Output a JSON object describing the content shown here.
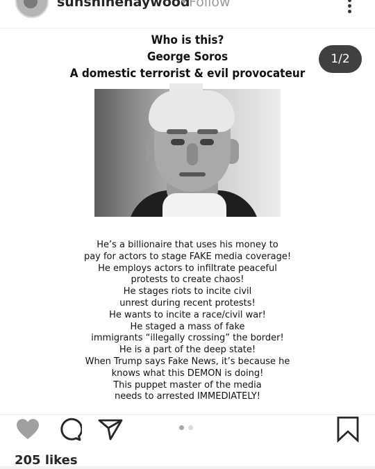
{
  "header": {
    "username": "sunshinehaywood",
    "separator": "•",
    "follow_label": "Follow"
  },
  "post": {
    "counter": "1/2",
    "headline": [
      "Who is this?",
      "George Soros",
      "A domestic terrorist & evil provocateur"
    ],
    "body_lines": [
      "He’s a billionaire that uses his money to",
      "pay for actors to stage FAKE media coverage!",
      "He employs actors to infiltrate peaceful",
      "protests to create chaos!",
      "He stages riots to incite civil",
      "unrest during recent protests!",
      "He wants to incite a race/civil war!",
      "He staged a mass of fake",
      "immigrants “illegally crossing” the border!",
      "He is a part of the deep state!",
      "When Trump says Fake News, it’s because he",
      "knows what this DEMON is doing!",
      "This puppet master of the media",
      "needs to arrested IMMEDIATELY!"
    ],
    "carousel": {
      "current": 1,
      "total": 2
    }
  },
  "actions": {
    "icons": [
      "heart-icon",
      "comment-icon",
      "share-icon",
      "bookmark-icon"
    ],
    "like_color": "#a0a0a0"
  },
  "likes_text": "205 likes"
}
